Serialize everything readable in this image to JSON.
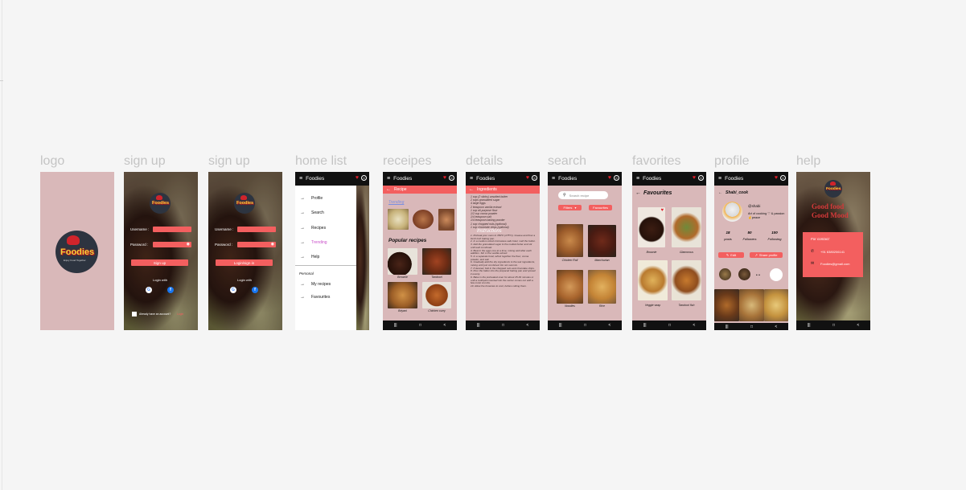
{
  "frames": {
    "logo": "logo",
    "signup1": "sign up",
    "signup2": "sign up",
    "home": "home list",
    "recipes": "receipes",
    "details": "details",
    "search": "search",
    "favorites": "favorites",
    "profile": "profile",
    "help": "help"
  },
  "brand": {
    "name": "Foodies",
    "tagline": "Enjoy Food Together"
  },
  "signup": {
    "username_label": "Username :",
    "password_label": "Password :",
    "button1": "Sign up",
    "button2": "Login/sign in",
    "login_with1": "Login with",
    "login_with2": "Login with",
    "google": "G",
    "facebook": "f",
    "already": "Already have an account?",
    "login_link": "Login"
  },
  "app": {
    "title": "Foodies",
    "menu_icon": "≡",
    "heart_icon": "♥",
    "user_icon": "☺",
    "back_icon": "←",
    "nav": [
      "|||",
      "□",
      "<"
    ]
  },
  "home": {
    "items": [
      "Profile",
      "Search",
      "Recipes",
      "Trending",
      "Help"
    ],
    "personal_heading": "Personal",
    "personal_items": [
      "My recipes",
      "Favourites"
    ]
  },
  "recipes": {
    "strip": "Recipe",
    "trending": "Trending",
    "popular": "Popular recipes",
    "items": [
      "Brownie",
      "Tandoori",
      "Briyani",
      "Chicken curry"
    ]
  },
  "details": {
    "strip": "Ingredients",
    "ingredients": [
      "1 cup (2 sticks) unsalted butter",
      "2 cups granulated sugar",
      "4 large eggs",
      "2 teaspoon vanilla extract",
      "1 cup all-purpose flour",
      "1/2 cup cocoa powder",
      "1/4 teaspoon salt",
      "1/4 teaspoon baking powder",
      "1 cup chopped nuts (optional)",
      "1 cup chocolate chips (optional)"
    ],
    "instructions_heading": "Instructions",
    "instructions": [
      "1. Preheat your oven to 350°F (175°C). Grease and flour a 9x13 inch baking pan.",
      "2. In a medium-sized microwave-safe bowl, melt the butter.",
      "3. Add the granulated sugar to the melted butter and stir until well combined.",
      "4. Beat in the eggs one at a time, mixing well after each addition. Stir in the vanilla extract.",
      "5. In a separate bowl, whisk together the flour, cocoa powder, and salt.",
      "6. Gradually add the dry ingredients to the wet ingredients, mixing until just combined. Do not overmix.",
      "7. If desired, fold in the chopped nuts and chocolate chips.",
      "8. Pour the batter into the prepared baking pan and spread it evenly.",
      "9. Bake in the preheated oven for about 25-30 minutes or until a toothpick inserted into the center comes out with a few moist crumbs.",
      "10. Allow the brownies to cool, before cutting them."
    ]
  },
  "search": {
    "placeholder": "Search recipe",
    "filters": "Filters",
    "favourites": "Favourites",
    "items": [
      "Chicken Roll",
      "Manchurian",
      "Noodles",
      "Rice"
    ]
  },
  "favorites": {
    "title": "Favourites",
    "items": [
      "Brownie",
      "Glamorous",
      "Veggie wrap",
      "Tandoori fish"
    ]
  },
  "profile": {
    "username": "Shabi_cook",
    "handle": "@shabi",
    "bio": "Art of cooking ♡ & passion ✌peace",
    "posts_count": "18",
    "posts_label": "posts",
    "followers_count": "50",
    "followers_label": "Followers",
    "following_count": "100",
    "following_label": "Following",
    "edit": "Edit",
    "share": "Share profile"
  },
  "help": {
    "headline1": "Good food",
    "headline2": "Good Mood",
    "contact_heading": "For contact:",
    "phone": "+91 6380206141",
    "email": "Foodies@gmail.com"
  },
  "colors": {
    "accent": "#f35f5f",
    "frame_bg": "#d9b8b9",
    "dark": "#111111"
  }
}
